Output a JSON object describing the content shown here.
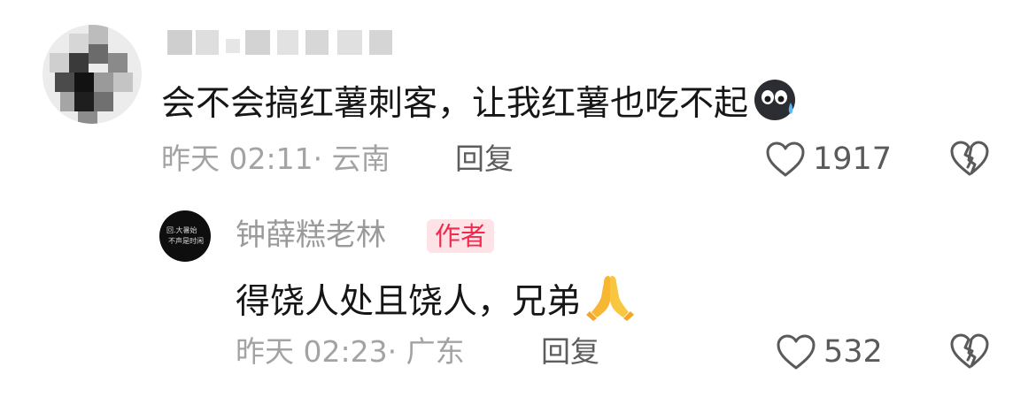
{
  "comment": {
    "username": "",
    "text": "会不会搞红薯刺客，让我红薯也吃不起",
    "emoji": "sweat-face-emoji",
    "meta": "昨天 02:11· 云南",
    "reply_label": "回复",
    "likes": "1917"
  },
  "reply": {
    "username": "钟薛糕老林",
    "badge": "作者",
    "text": "得饶人处且饶人，兄弟",
    "emoji": "folded-hands-emoji",
    "meta": "昨天 02:23· 广东",
    "reply_label": "回复",
    "likes": "532"
  },
  "colors": {
    "text": "#161616",
    "meta": "#a3a3a3",
    "badge_bg": "#fde3e6",
    "badge_text": "#f12a4f"
  }
}
